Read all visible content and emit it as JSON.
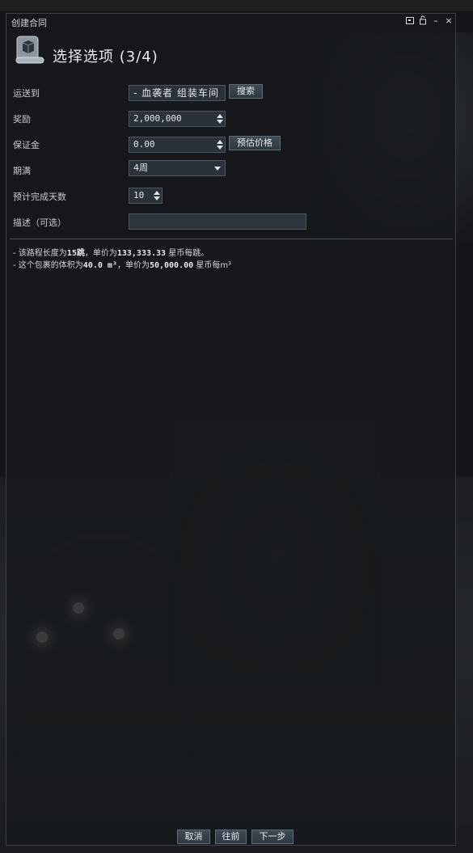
{
  "window": {
    "title": "创建合同",
    "page_title": "选择选项 (3/4)",
    "controls": {
      "minimize": "",
      "lock": "",
      "dash": "–",
      "close": "×"
    }
  },
  "form": {
    "destination": {
      "label": "运送到",
      "value": "- 血袭者 组装车间",
      "search_button": "搜索"
    },
    "reward": {
      "label": "奖励",
      "value": "2,000,000"
    },
    "collateral": {
      "label": "保证金",
      "value": "0.00",
      "estimate_button": "预估价格"
    },
    "expiration": {
      "label": "期满",
      "value": "4周"
    },
    "days_to_complete": {
      "label": "预计完成天数",
      "value": "10"
    },
    "description": {
      "label": "描述（可选）",
      "value": ""
    }
  },
  "info": {
    "route": {
      "prefix": "- 该路程长度为",
      "jumps": "15跳",
      "mid": "，单价为",
      "price": "133,333.33",
      "suffix": " 星币每跳。"
    },
    "volume": {
      "prefix": "- 这个包裹的体积为",
      "volume": "40.0 m³",
      "mid": "，单价为",
      "price": "50,000.00",
      "suffix": " 星币每m³"
    }
  },
  "footer": {
    "cancel": "取消",
    "back": "往前",
    "next": "下一步"
  },
  "colors": {
    "field_bg": "#2a3138",
    "button_bg": "#3a444e",
    "window_bg": "#16181b"
  },
  "icons": {
    "header": "contract-scroll-icon"
  }
}
